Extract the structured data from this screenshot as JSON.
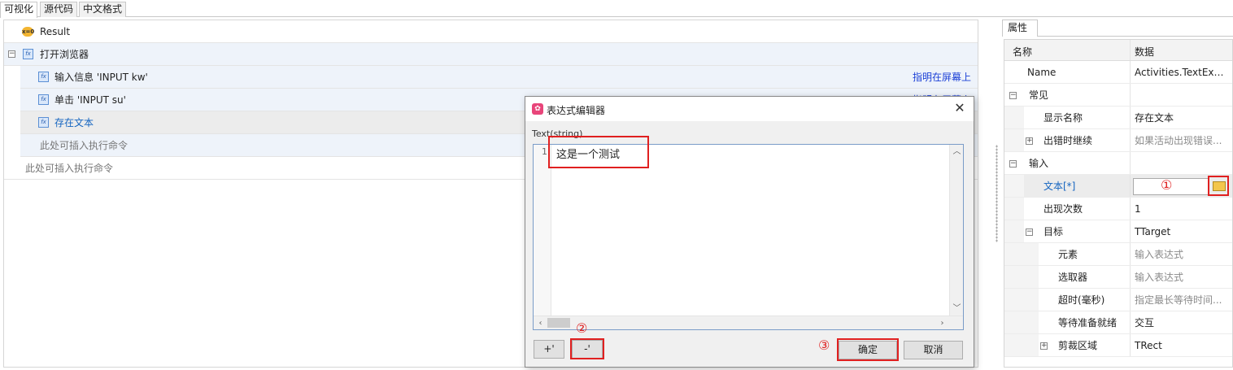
{
  "tabs": [
    "可视化",
    "源代码",
    "中文格式"
  ],
  "workflow": {
    "rows": [
      {
        "label": "Result",
        "icon": "result-icon"
      },
      {
        "label": "打开浏览器",
        "icon": "function-icon"
      },
      {
        "label": "输入信息 'INPUT kw'",
        "icon": "function-icon",
        "right": "指明在屏幕上"
      },
      {
        "label": "单击 'INPUT su'",
        "icon": "function-icon",
        "right": "指明在屏幕上"
      },
      {
        "label": "存在文本",
        "icon": "function-icon"
      },
      {
        "label": "此处可插入执行命令"
      },
      {
        "label": "此处可插入执行命令"
      }
    ]
  },
  "properties": {
    "tab": "属性",
    "col_name": "名称",
    "col_data": "数据",
    "rows": [
      {
        "name": "Name",
        "value": "Activities.TextExi..."
      },
      {
        "name": "常见",
        "value": ""
      },
      {
        "name": "显示名称",
        "value": "存在文本"
      },
      {
        "name": "出错时继续",
        "value": "如果活动出现错误..."
      },
      {
        "name": "输入",
        "value": ""
      },
      {
        "name": "文本[*]",
        "value": ""
      },
      {
        "name": "出现次数",
        "value": "1"
      },
      {
        "name": "目标",
        "value": "TTarget"
      },
      {
        "name": "元素",
        "value": "输入表达式"
      },
      {
        "name": "选取器",
        "value": "输入表达式"
      },
      {
        "name": "超时(毫秒)",
        "value": "指定最长等待时间..."
      },
      {
        "name": "等待准备就绪",
        "value": "交互"
      },
      {
        "name": "剪裁区域",
        "value": "TRect"
      }
    ]
  },
  "dialog": {
    "title": "表达式编辑器",
    "type_label": "Text(string)",
    "line_number": "1",
    "code": "这是一个测试",
    "btn_plus": "+'",
    "btn_minus": "-'",
    "btn_ok": "确定",
    "btn_cancel": "取消",
    "close": "✕"
  },
  "annotations": [
    "①",
    "②",
    "③"
  ],
  "colors": {
    "annotation": "#e02020",
    "link": "#1a3fd6",
    "selected_label": "#1565c0"
  }
}
